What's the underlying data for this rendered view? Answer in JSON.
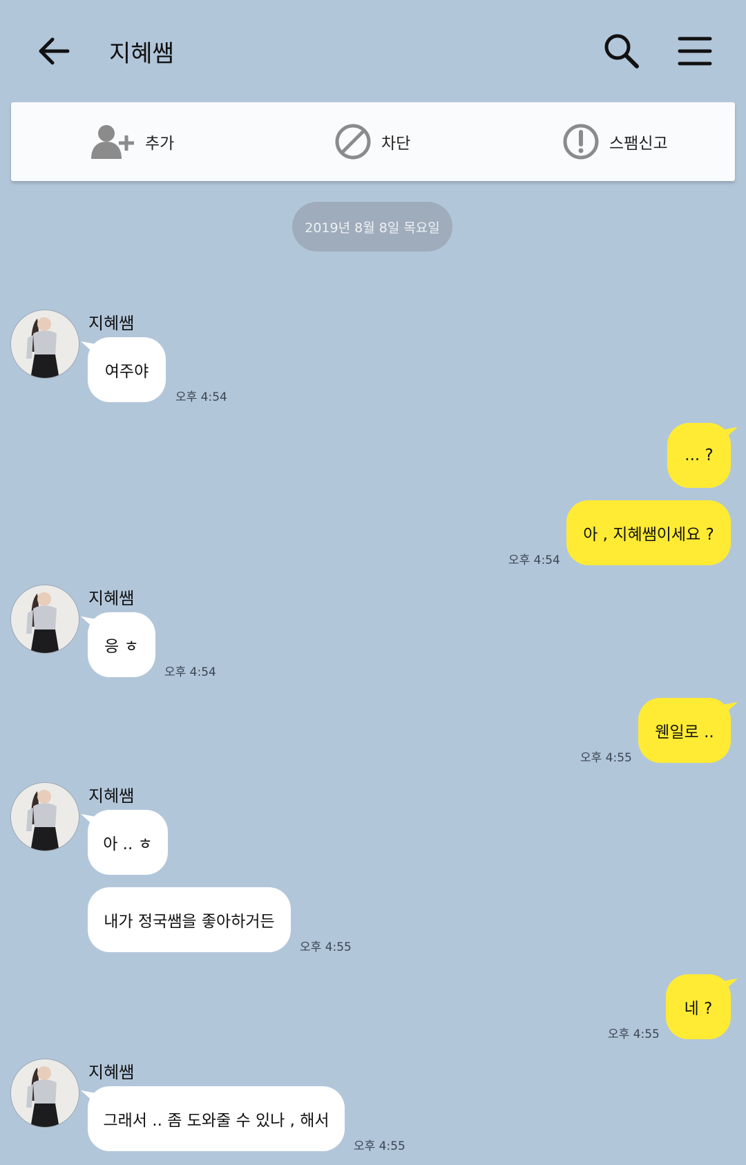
{
  "header": {
    "title": "지혜쌤"
  },
  "actions": [
    {
      "label": "추가",
      "icon": "add-friend-icon"
    },
    {
      "label": "차단",
      "icon": "block-icon"
    },
    {
      "label": "스팸신고",
      "icon": "report-spam-icon"
    }
  ],
  "date_divider": "2019년 8월 8일 목요일",
  "colors": {
    "background": "#b2c6da",
    "incoming_bubble": "#ffffff",
    "outgoing_bubble": "#ffeb33",
    "date_pill": "#9facbb"
  },
  "messages": [
    {
      "direction": "in",
      "sender": "지혜쌤",
      "text": "여주야",
      "time": "오후 4:54"
    },
    {
      "direction": "out",
      "text": "... ?",
      "time": ""
    },
    {
      "direction": "out",
      "text": "아 , 지혜쌤이세요 ?",
      "time": "오후 4:54"
    },
    {
      "direction": "in",
      "sender": "지혜쌤",
      "text": "응 ㅎ",
      "time": "오후 4:54"
    },
    {
      "direction": "out",
      "text": "웬일로 ..",
      "time": "오후 4:55"
    },
    {
      "direction": "in",
      "sender": "지혜쌤",
      "text": "아 .. ㅎ",
      "time": ""
    },
    {
      "direction": "in",
      "text": "내가 정국쌤을 좋아하거든",
      "time": "오후 4:55"
    },
    {
      "direction": "out",
      "text": "네 ?",
      "time": "오후 4:55"
    },
    {
      "direction": "in",
      "sender": "지혜쌤",
      "text": "그래서 .. 좀 도와줄 수 있나 , 해서",
      "time": "오후 4:55"
    }
  ]
}
